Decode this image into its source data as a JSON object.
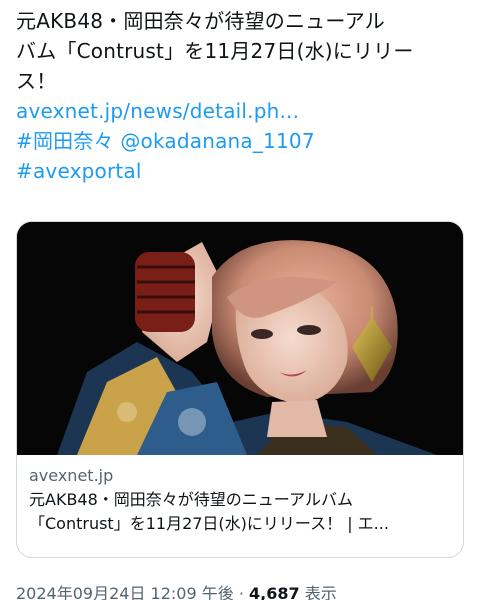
{
  "tweet": {
    "text_line1": "元AKB48・岡田奈々が待望のニューアル",
    "text_line2": "バム「Contrust」を11月27日(水)にリリー",
    "text_line3": "ス！",
    "link": "avexnet.jp/news/detail.ph...",
    "mention_line": "#岡田奈々 @okadanana_1107",
    "hashtag": "#avexportal"
  },
  "card": {
    "domain": "avexnet.jp",
    "title_line1": "元AKB48・岡田奈々が待望のニューアルバム",
    "title_line2": "「Contrust」を11月27日(水)にリリース！ | エ..."
  },
  "meta": {
    "date": "2024年09月24日 12:09 午後",
    "separator": " · ",
    "views_count": "4,687",
    "views_label": " 表示"
  },
  "colors": {
    "link": "#1d9bf0",
    "text": "#0f1419",
    "secondary": "#536471",
    "border": "#cfd9de"
  }
}
